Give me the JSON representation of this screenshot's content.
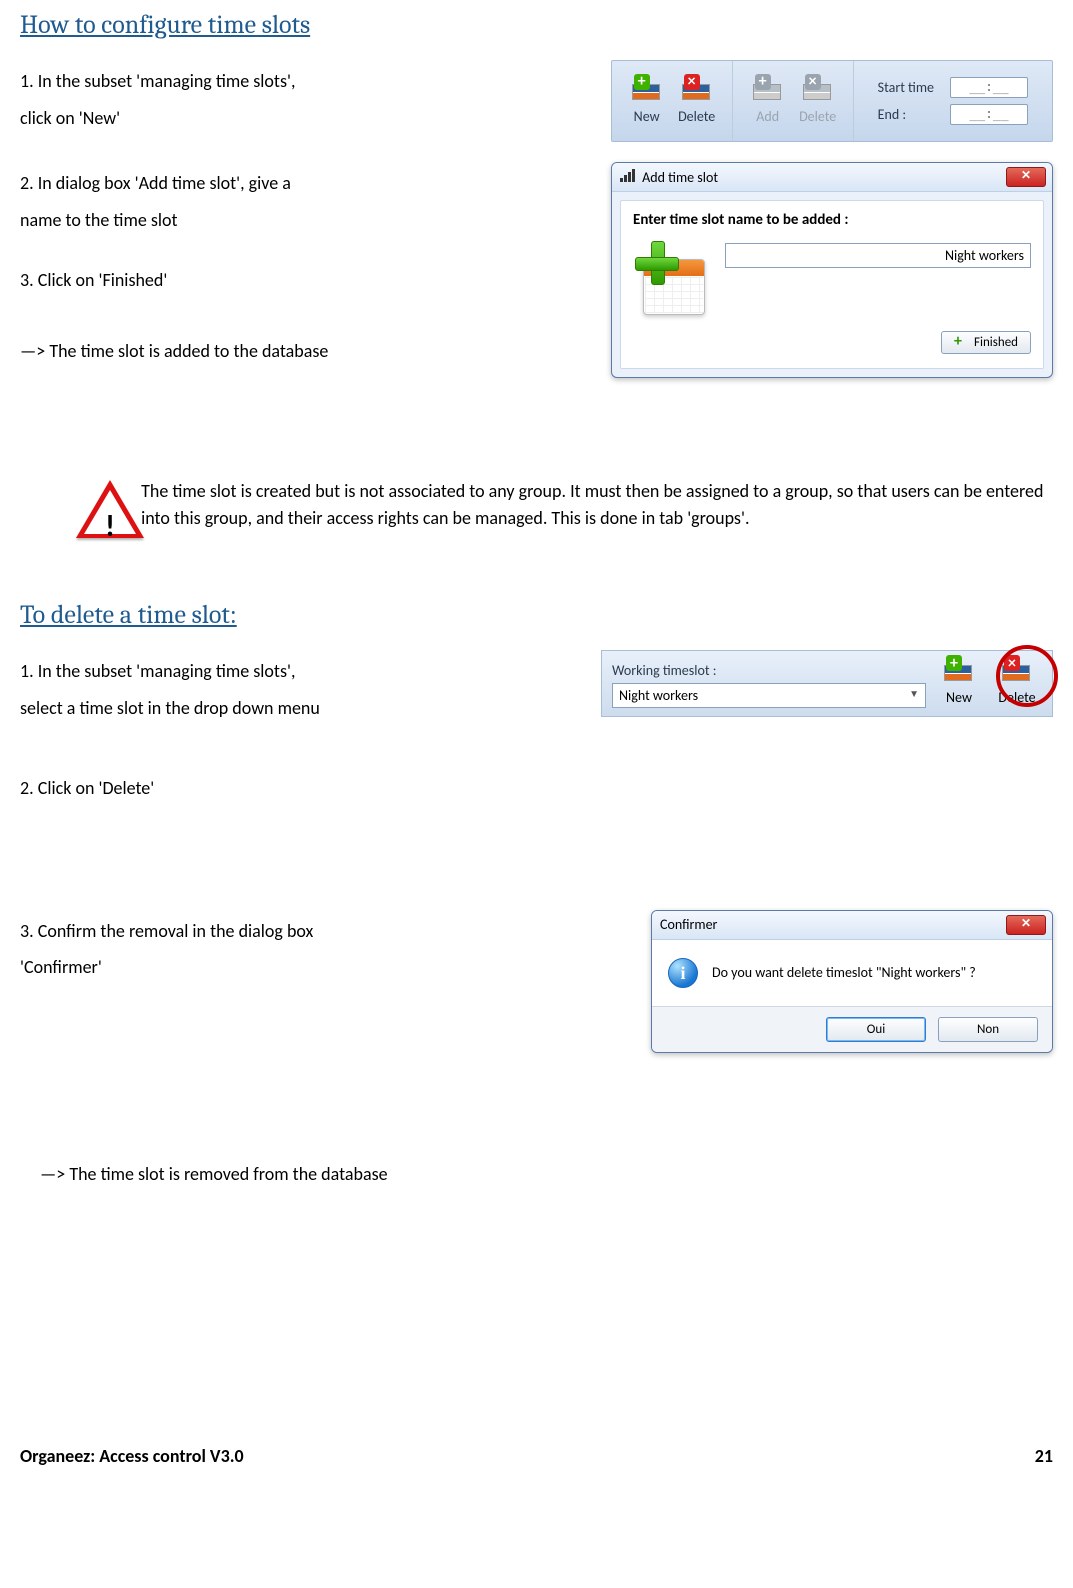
{
  "section1": {
    "heading": "How to configure time slots",
    "step1a": "1. In the subset 'managing time slots',",
    "step1b": "click on 'New'",
    "step2a": "2. In dialog box 'Add time slot', give a",
    "step2b": "name to the time slot",
    "step3": "3. Click on 'Finished'",
    "result": "—> The time slot is added to the database"
  },
  "ribbon": {
    "btn_new": "New",
    "btn_delete": "Delete",
    "btn_add": "Add",
    "btn_delete2": "Delete",
    "lbl_start": "Start time",
    "lbl_end": "End :",
    "time_placeholder": "__:__"
  },
  "dialog_add": {
    "title": "Add time slot",
    "prompt": "Enter time slot name to be added :",
    "input_value": "Night workers",
    "finished": "Finished"
  },
  "warning": {
    "text": "The time slot is created but is not associated to any group. It must then be assigned to a group, so that users can be entered into this group, and their access rights can be managed. This is done in tab 'groups'."
  },
  "section2": {
    "heading": "To delete a time slot:",
    "step1a": "1. In the subset 'managing time slots',",
    "step1b": "select a time slot in the drop down menu",
    "step2": "2. Click on 'Delete'",
    "step3a": "3. Confirm the removal in the dialog box",
    "step3b": "'Confirmer'",
    "result": "—> The time slot is removed from the database"
  },
  "tsbar": {
    "label": "Working timeslot :",
    "value": "Night workers",
    "btn_new": "New",
    "btn_delete": "Delete"
  },
  "confirm": {
    "title": "Confirmer",
    "message": "Do you want delete timeslot \"Night workers\" ?",
    "yes": "Oui",
    "no": "Non"
  },
  "footer": {
    "left": "Organeez: Access control     V3.0",
    "page": "21"
  }
}
